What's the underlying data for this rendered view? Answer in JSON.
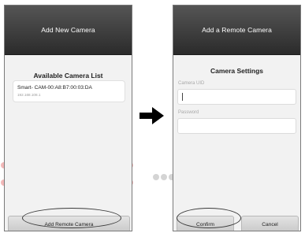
{
  "left_screen": {
    "title": "Add New Camera",
    "list_heading": "Available Camera List",
    "camera": {
      "name": "Smart- CAM-00:A8:B7:00:03:DA",
      "ip": "192.168.108.1"
    },
    "add_remote_button": "Add Remote Camera"
  },
  "right_screen": {
    "title": "Add a Remote Camera",
    "heading": "Camera Settings",
    "uid_label": "Camera UID",
    "password_label": "Password",
    "confirm_button": "Confirm",
    "cancel_button": "Cancel"
  },
  "arrow_icon": "right-arrow-icon",
  "colors": {
    "appbar": "#3a3a3a",
    "screen_background": "#f2f2f2",
    "highlight_outline": "#3a3a3a",
    "watermark_gray": "#d4d4d4",
    "watermark_red": "#f2b8b8"
  }
}
